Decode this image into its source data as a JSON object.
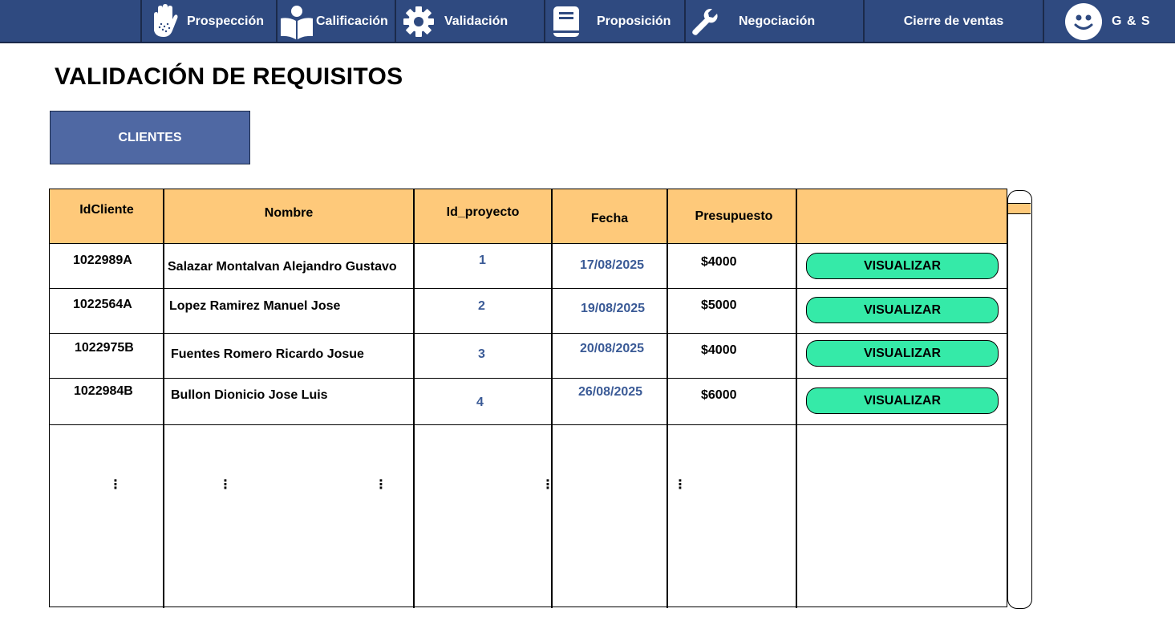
{
  "nav": {
    "items": [
      {
        "label": "Prospección",
        "icon": "hand-icon"
      },
      {
        "label": "Calificación",
        "icon": "reader-icon"
      },
      {
        "label": "Validación",
        "icon": "gear-icon"
      },
      {
        "label": "Proposición",
        "icon": "book-icon"
      },
      {
        "label": "Negociación",
        "icon": "wrench-icon"
      },
      {
        "label": "Cierre de ventas",
        "icon": ""
      }
    ],
    "brand": "G & S",
    "avatar_icon": "smiley-face-icon"
  },
  "page": {
    "title": "VALIDACIÓN DE REQUISITOS",
    "tab_label": "CLIENTES"
  },
  "table": {
    "headers": [
      "IdCliente",
      "Nombre",
      "Id_proyecto",
      "Fecha",
      "Presupuesto",
      ""
    ],
    "rows": [
      {
        "id": "1022989A",
        "name": "Salazar Montalvan Alejandro Gustavo",
        "project": "1",
        "date": "17/08/2025",
        "budget": "$4000",
        "action": "VISUALIZAR"
      },
      {
        "id": "1022564A",
        "name": "Lopez Ramirez Manuel Jose",
        "project": "2",
        "date": "19/08/2025",
        "budget": "$5000",
        "action": "VISUALIZAR"
      },
      {
        "id": "1022975B",
        "name": "Fuentes Romero Ricardo Josue",
        "project": "3",
        "date": "20/08/2025",
        "budget": "$4000",
        "action": "VISUALIZAR"
      },
      {
        "id": "1022984B",
        "name": "Bullon Dionicio Jose Luis",
        "project": "4",
        "date": "26/08/2025",
        "budget": "$6000",
        "action": "VISUALIZAR"
      }
    ],
    "continuation": "⋮"
  },
  "colors": {
    "nav_bg": "#2f4a80",
    "tab_bg": "#4f68a3",
    "header_bg": "#fec97a",
    "button_bg": "#35eaa8",
    "link_text": "#3a5a96"
  }
}
